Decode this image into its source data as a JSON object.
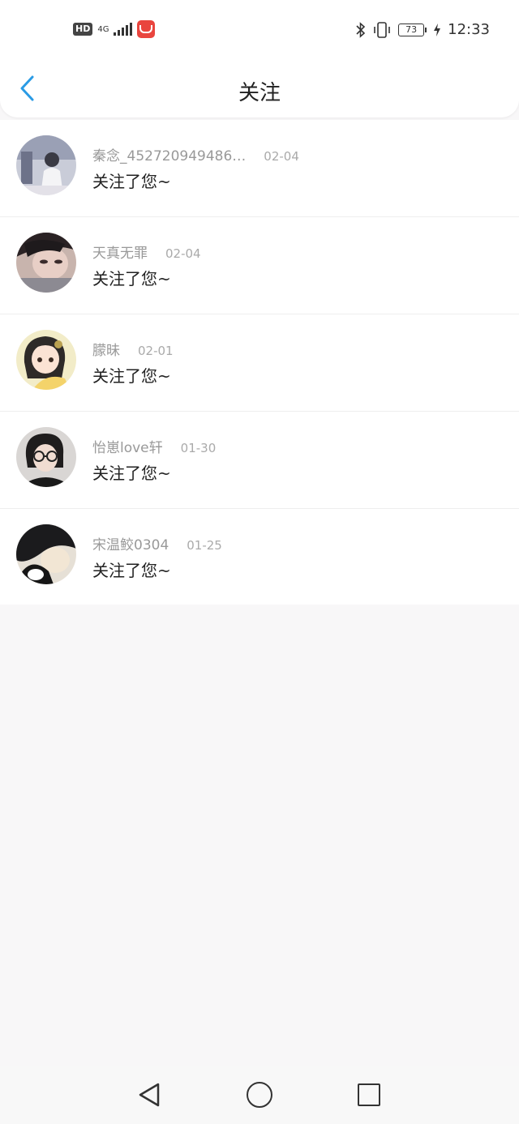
{
  "status_bar": {
    "hd": "HD",
    "network": "4G",
    "battery": "73",
    "time": "12:33"
  },
  "header": {
    "title": "关注"
  },
  "items": [
    {
      "name": "秦念_452720949486…",
      "date": "02-04",
      "message": "关注了您~"
    },
    {
      "name": "天真无罪",
      "date": "02-04",
      "message": "关注了您~"
    },
    {
      "name": "朦昧",
      "date": "02-01",
      "message": "关注了您~"
    },
    {
      "name": "怡崽love轩",
      "date": "01-30",
      "message": "关注了您~"
    },
    {
      "name": "宋温鲛0304",
      "date": "01-25",
      "message": "关注了您~"
    }
  ],
  "colors": {
    "accent": "#2a9be5",
    "background": "#f8f7f8"
  }
}
